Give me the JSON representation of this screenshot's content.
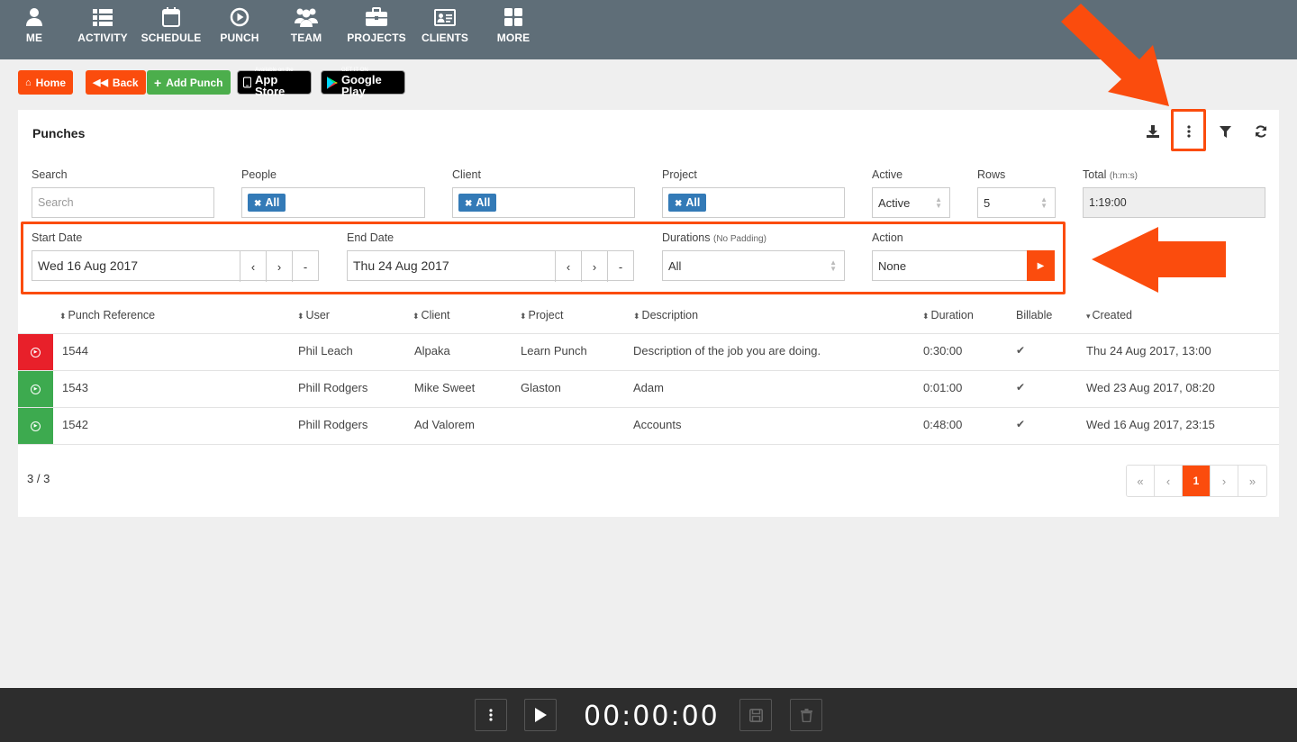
{
  "nav": [
    {
      "label": "ME",
      "icon": "user-icon"
    },
    {
      "label": "ACTIVITY",
      "icon": "list-icon"
    },
    {
      "label": "SCHEDULE",
      "icon": "calendar-icon"
    },
    {
      "label": "PUNCH",
      "icon": "play-circle-icon"
    },
    {
      "label": "TEAM",
      "icon": "users-icon"
    },
    {
      "label": "PROJECTS",
      "icon": "briefcase-icon"
    },
    {
      "label": "CLIENTS",
      "icon": "id-card-icon"
    },
    {
      "label": "MORE",
      "icon": "grid-icon"
    }
  ],
  "toolbar": {
    "home": "Home",
    "back": "Back",
    "add_punch": "Add Punch",
    "app_store_small": "Available on the",
    "app_store_big": "App Store",
    "google_small": "GET IT ON",
    "google_big": "Google Play"
  },
  "panel": {
    "title": "Punches"
  },
  "filters": {
    "search_label": "Search",
    "search_placeholder": "Search",
    "people_label": "People",
    "people_tag": "All",
    "client_label": "Client",
    "client_tag": "All",
    "project_label": "Project",
    "project_tag": "All",
    "active_label": "Active",
    "active_value": "Active",
    "rows_label": "Rows",
    "rows_value": "5",
    "total_label": "Total",
    "total_unit": "(h:m:s)",
    "total_value": "1:19:00",
    "start_label": "Start Date",
    "start_value": "Wed 16 Aug 2017",
    "end_label": "End Date",
    "end_value": "Thu 24 Aug 2017",
    "prev": "‹",
    "next": "›",
    "clear": "-",
    "durations_label": "Durations",
    "durations_note": "(No Padding)",
    "durations_value": "All",
    "action_label": "Action",
    "action_value": "None"
  },
  "table": {
    "headers": [
      "Punch Reference",
      "User",
      "Client",
      "Project",
      "Description",
      "Duration",
      "Billable",
      "Created"
    ],
    "rows": [
      {
        "ref": "1544",
        "user": "Phil Leach",
        "client": "Alpaka",
        "project": "Learn Punch",
        "description": "Description of the job you are doing.",
        "duration": "0:30:00",
        "created": "Thu 24 Aug 2017, 13:00",
        "status_color": "#e8202a"
      },
      {
        "ref": "1543",
        "user": "Phill Rodgers",
        "client": "Mike Sweet",
        "project": "Glaston",
        "description": "Adam",
        "duration": "0:01:00",
        "created": "Wed 23 Aug 2017, 08:20",
        "status_color": "#3daa4f"
      },
      {
        "ref": "1542",
        "user": "Phill Rodgers",
        "client": "Ad Valorem",
        "project": "",
        "description": "Accounts",
        "duration": "0:48:00",
        "created": "Wed 16 Aug 2017, 23:15",
        "status_color": "#3daa4f"
      }
    ],
    "count": "3 / 3"
  },
  "pagination": {
    "first": "«",
    "prev": "‹",
    "current": "1",
    "next": "›",
    "last": "»"
  },
  "bottom": {
    "timer": "00:00:00"
  },
  "colors": {
    "accent": "#fb4c0d",
    "nav_bg": "#5f6e78",
    "tag_blue": "#337ab7",
    "add_green": "#4cae4c"
  }
}
